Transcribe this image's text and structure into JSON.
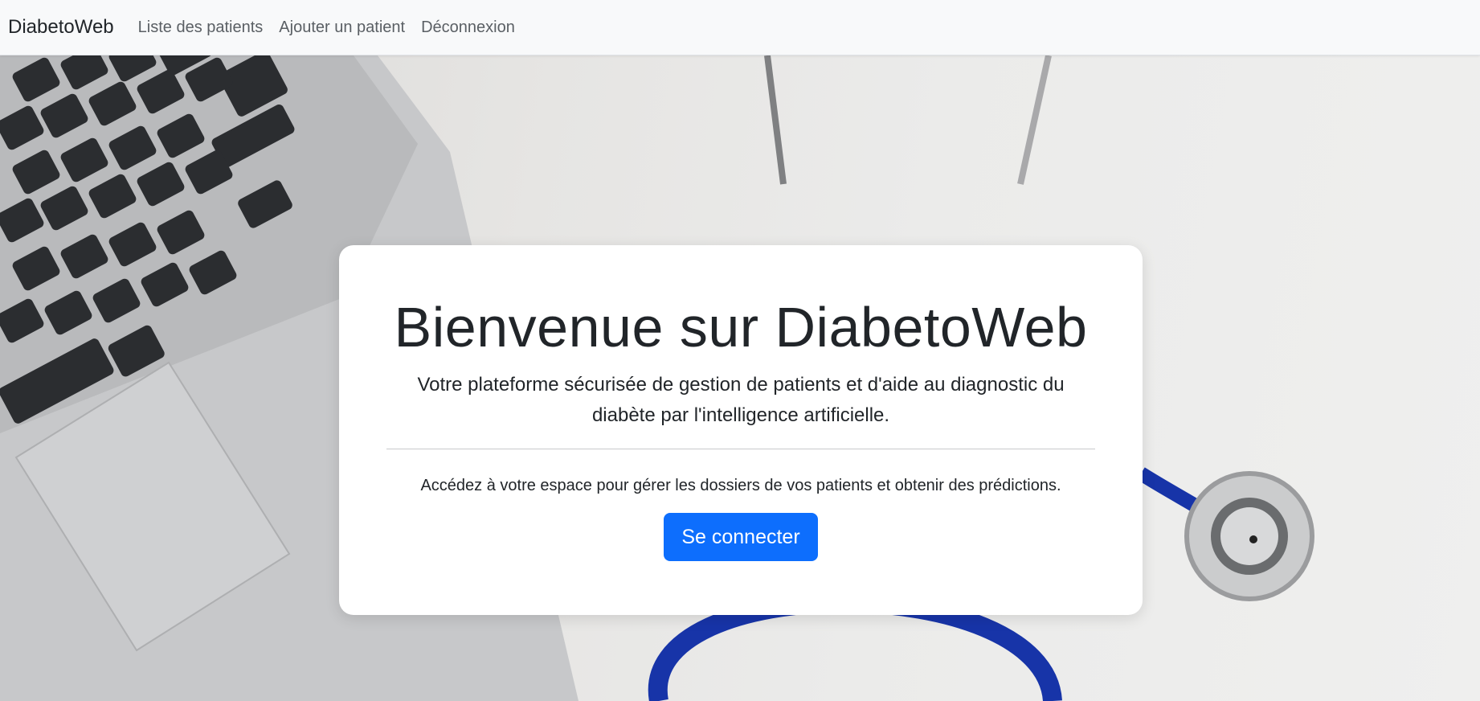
{
  "navbar": {
    "brand": "DiabetoWeb",
    "links": [
      "Liste des patients",
      "Ajouter un patient",
      "Déconnexion"
    ]
  },
  "hero": {
    "title": "Bienvenue sur DiabetoWeb",
    "subtitle": "Votre plateforme sécurisée de gestion de patients et d'aide au diagnostic du diabète par l'intelligence artificielle.",
    "lead": "Accédez à votre espace pour gérer les dossiers de vos patients et obtenir des prédictions.",
    "login_button": "Se connecter"
  },
  "colors": {
    "primary": "#0d6efd",
    "navbar_bg": "#f8f9fa",
    "text": "#212529"
  }
}
